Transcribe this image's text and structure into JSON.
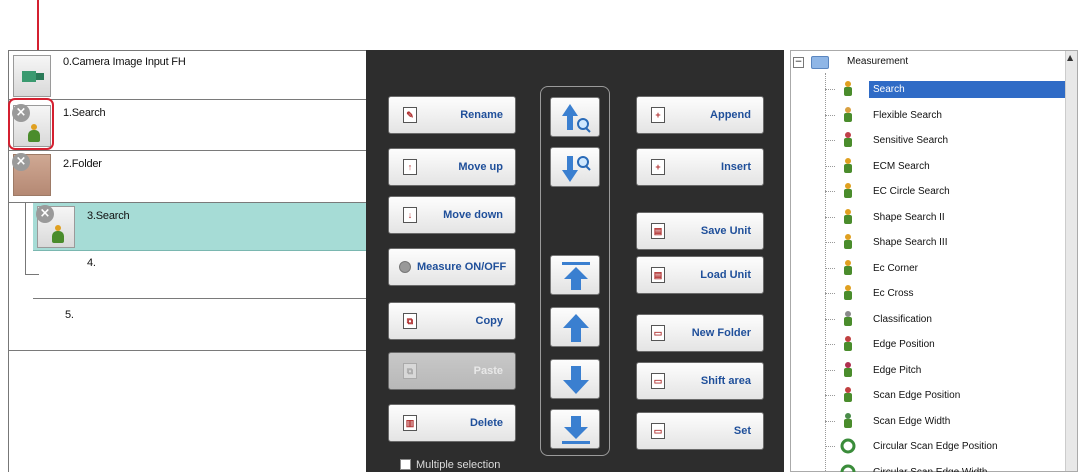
{
  "flow": {
    "items": [
      {
        "label": "0.Camera Image Input FH"
      },
      {
        "label": "1.Search"
      },
      {
        "label": "2.Folder"
      },
      {
        "label": "3.Search"
      },
      {
        "label": "4."
      },
      {
        "label": "5."
      }
    ]
  },
  "buttons": {
    "rename": "Rename",
    "move_up": "Move up",
    "move_down": "Move down",
    "measure": "Measure ON/OFF",
    "copy": "Copy",
    "paste": "Paste",
    "delete": "Delete",
    "append": "Append",
    "insert": "Insert",
    "save_unit": "Save Unit",
    "load_unit": "Load Unit",
    "new_folder": "New Folder",
    "shift_area": "Shift area",
    "set": "Set"
  },
  "multiple_selection": "Multiple selection",
  "tree": {
    "root": "Measurement",
    "items": [
      {
        "label": "Search",
        "icon": "search-person-icon"
      },
      {
        "label": "Flexible Search",
        "icon": "flexible-search-icon"
      },
      {
        "label": "Sensitive Search",
        "icon": "sensitive-search-icon"
      },
      {
        "label": "ECM Search",
        "icon": "ecm-search-icon"
      },
      {
        "label": "EC Circle Search",
        "icon": "ec-circle-search-icon"
      },
      {
        "label": "Shape Search II",
        "icon": "shape-search-icon"
      },
      {
        "label": "Shape Search III",
        "icon": "shape-search-icon"
      },
      {
        "label": "Ec Corner",
        "icon": "ec-corner-icon"
      },
      {
        "label": "Ec Cross",
        "icon": "ec-cross-icon"
      },
      {
        "label": "Classification",
        "icon": "classification-icon"
      },
      {
        "label": "Edge Position",
        "icon": "edge-position-icon"
      },
      {
        "label": "Edge Pitch",
        "icon": "edge-pitch-icon"
      },
      {
        "label": "Scan Edge Position",
        "icon": "scan-edge-position-icon"
      },
      {
        "label": "Scan Edge Width",
        "icon": "scan-edge-width-icon"
      },
      {
        "label": "Circular Scan Edge Position",
        "icon": "circular-scan-icon"
      },
      {
        "label": "Circular Scan Edge Width",
        "icon": "circular-scan-icon"
      }
    ]
  },
  "colors": {
    "accent": "#d42030",
    "selected_row": "#a6dcd6",
    "tree_selection": "#2f6bc6",
    "button_text": "#1f4f9a"
  }
}
